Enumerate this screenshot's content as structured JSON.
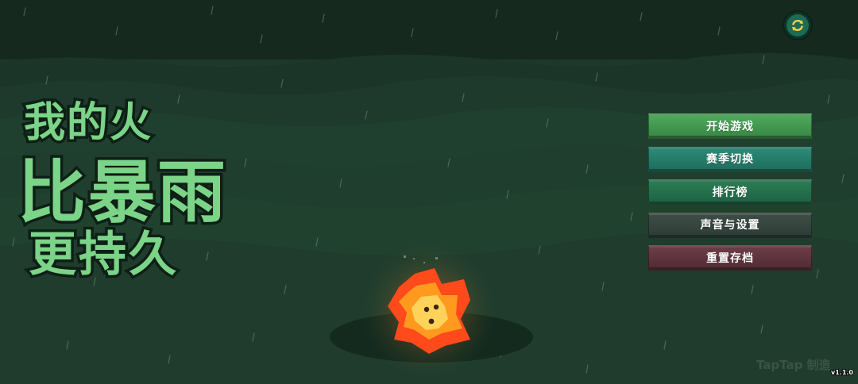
{
  "title": {
    "line1": "我的火",
    "line2": "比暴雨",
    "line3": "更持久"
  },
  "menu": {
    "items": [
      {
        "label": "开始游戏"
      },
      {
        "label": "赛季切换"
      },
      {
        "label": "排行榜"
      },
      {
        "label": "声音与设置"
      },
      {
        "label": "重置存档"
      }
    ]
  },
  "refresh_icon": "refresh-icon",
  "watermark": "TapTap 制造",
  "version": "v1.1.0",
  "colors": {
    "background": "#1d3a2c",
    "title_fill": "#7bd488",
    "title_outline": "#0e1f16",
    "fire_outer": "#ff4a1c",
    "fire_mid": "#ff9a1f",
    "fire_core": "#ffe27a"
  }
}
